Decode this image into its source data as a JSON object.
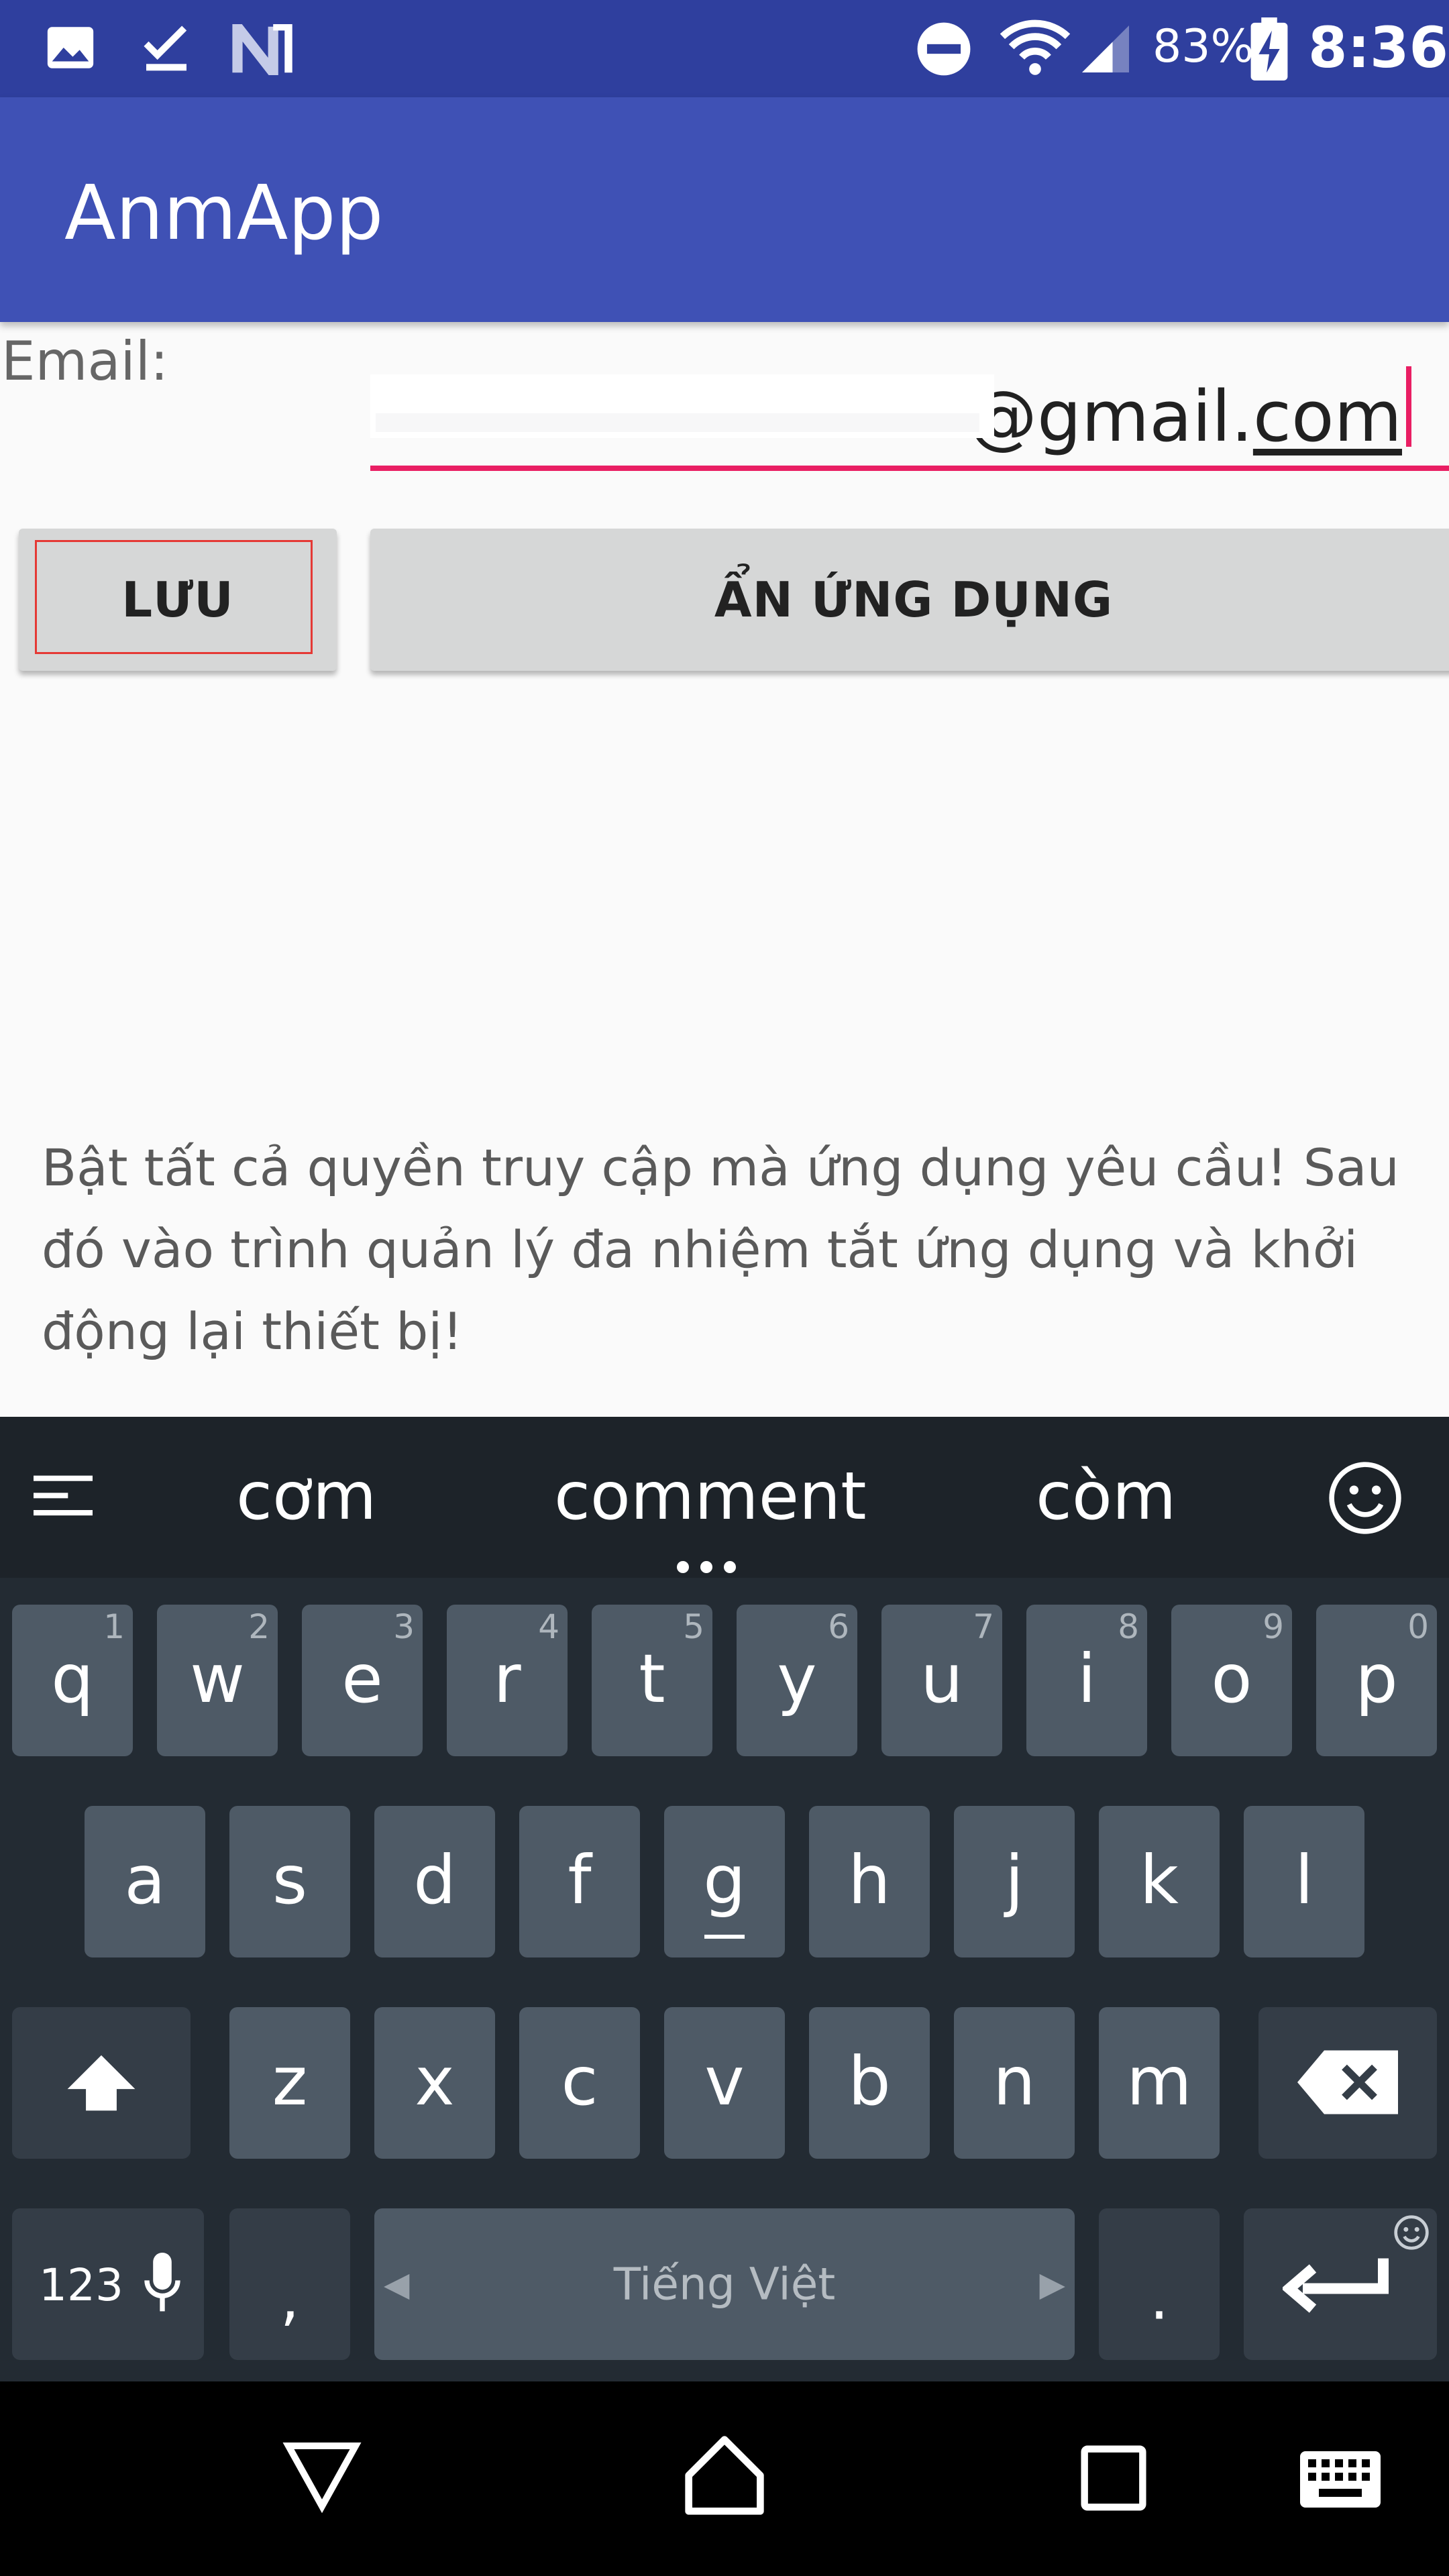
{
  "status_bar": {
    "battery_percent": "83%",
    "time": "8:36",
    "icons": [
      "image-icon",
      "check-icon",
      "n-logo-icon",
      "do-not-disturb-icon",
      "wifi-icon",
      "signal-icon",
      "battery-charging-icon"
    ]
  },
  "app_bar": {
    "title": "AnmApp"
  },
  "form": {
    "email_label": "Email:",
    "email_value_visible_prefix": "@gmail.",
    "email_value_visible_suffix": "com",
    "save_button": "LƯU",
    "hide_app_button": "ẨN ỨNG DỤNG",
    "instructions": "Bật tất cả quyền truy cập mà ứng dụng yêu cầu! Sau đó vào trình quản lý đa nhiệm tắt ứng dụng và khởi động lại thiết bị!"
  },
  "keyboard": {
    "suggestions": [
      "cơm",
      "comment",
      "còm"
    ],
    "row1": [
      {
        "key": "q",
        "hint": "1"
      },
      {
        "key": "w",
        "hint": "2"
      },
      {
        "key": "e",
        "hint": "3"
      },
      {
        "key": "r",
        "hint": "4"
      },
      {
        "key": "t",
        "hint": "5"
      },
      {
        "key": "y",
        "hint": "6"
      },
      {
        "key": "u",
        "hint": "7"
      },
      {
        "key": "i",
        "hint": "8"
      },
      {
        "key": "o",
        "hint": "9"
      },
      {
        "key": "p",
        "hint": "0"
      }
    ],
    "row2": [
      "a",
      "s",
      "d",
      "f",
      "g",
      "h",
      "j",
      "k",
      "l"
    ],
    "row3": [
      "z",
      "x",
      "c",
      "v",
      "b",
      "n",
      "m"
    ],
    "symbols_key": "123",
    "comma_key": ",",
    "space_key": "Tiếng Việt",
    "period_key": ".",
    "colors": {
      "background": "#232b33",
      "key": "#4e5a66",
      "modifier_key": "#343d47"
    }
  },
  "colors": {
    "primary": "#3f51b5",
    "primary_dark": "#2f3f9e",
    "accent": "#e91e63"
  }
}
